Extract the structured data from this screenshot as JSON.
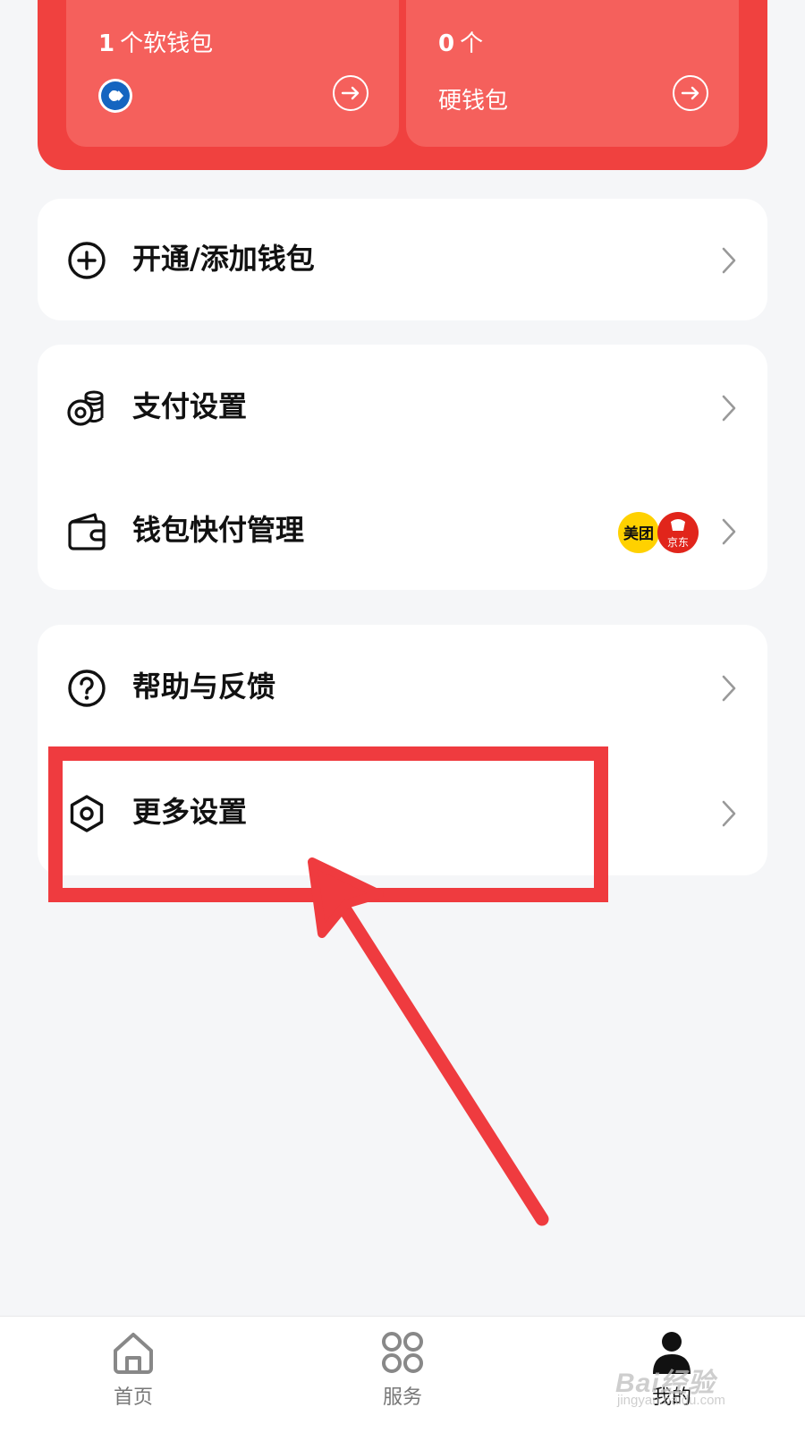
{
  "wallets": {
    "soft": {
      "count": "1",
      "label": "个软钱包"
    },
    "hard": {
      "count": "0",
      "label": "个",
      "sub_label": "硬钱包"
    }
  },
  "menu": {
    "group1": [
      {
        "label": "开通/添加钱包",
        "icon": "add-circle-icon"
      }
    ],
    "group2": [
      {
        "label": "支付设置",
        "icon": "coins-icon"
      },
      {
        "label": "钱包快付管理",
        "icon": "wallet-icon",
        "partners": [
          "美团",
          "京东"
        ]
      }
    ],
    "group3": [
      {
        "label": "帮助与反馈",
        "icon": "help-icon"
      },
      {
        "label": "更多设置",
        "icon": "settings-hexagon-icon"
      }
    ]
  },
  "bottom_nav": [
    {
      "label": "首页",
      "icon": "home-icon",
      "active": false
    },
    {
      "label": "服务",
      "icon": "grid-icon",
      "active": false
    },
    {
      "label": "我的",
      "icon": "user-icon",
      "active": true
    }
  ],
  "watermark": {
    "main": "Bai经验",
    "sub": "jingyan.baidu.com"
  },
  "colors": {
    "brand_red": "#f0413f",
    "tile_red": "#f5605c",
    "annotation_red": "#ef3b3f",
    "background": "#f5f6f8"
  }
}
